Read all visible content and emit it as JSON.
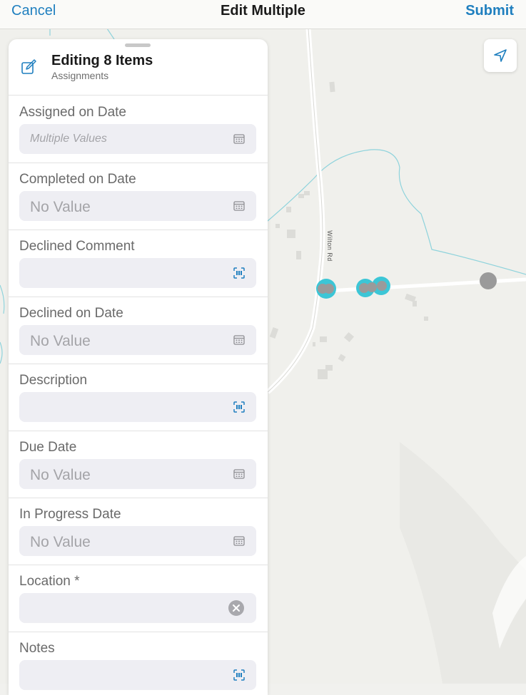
{
  "nav": {
    "cancel": "Cancel",
    "title": "Edit Multiple",
    "submit": "Submit"
  },
  "panel": {
    "title": "Editing 8 Items",
    "subtitle": "Assignments",
    "fields": [
      {
        "label": "Assigned on Date",
        "value": "Multiple Values",
        "icon": "calendar-icon"
      },
      {
        "label": "Completed on Date",
        "value": "No Value",
        "icon": "calendar-icon"
      },
      {
        "label": "Declined Comment",
        "value": "",
        "icon": "scan-icon"
      },
      {
        "label": "Declined on Date",
        "value": "No Value",
        "icon": "calendar-icon"
      },
      {
        "label": "Description",
        "value": "",
        "icon": "scan-icon"
      },
      {
        "label": "Due Date",
        "value": "No Value",
        "icon": "calendar-icon"
      },
      {
        "label": "In Progress Date",
        "value": "No Value",
        "icon": "calendar-icon"
      },
      {
        "label": "Location *",
        "value": "",
        "icon": "clear-icon"
      },
      {
        "label": "Notes",
        "value": "",
        "icon": "scan-icon"
      }
    ]
  },
  "map": {
    "road_label": "Wilton Rd",
    "locate_icon": "location-arrow-icon"
  },
  "colors": {
    "accent": "#1f7fbf",
    "selection": "#3cc6d6",
    "marker": "#9a9a9a"
  }
}
